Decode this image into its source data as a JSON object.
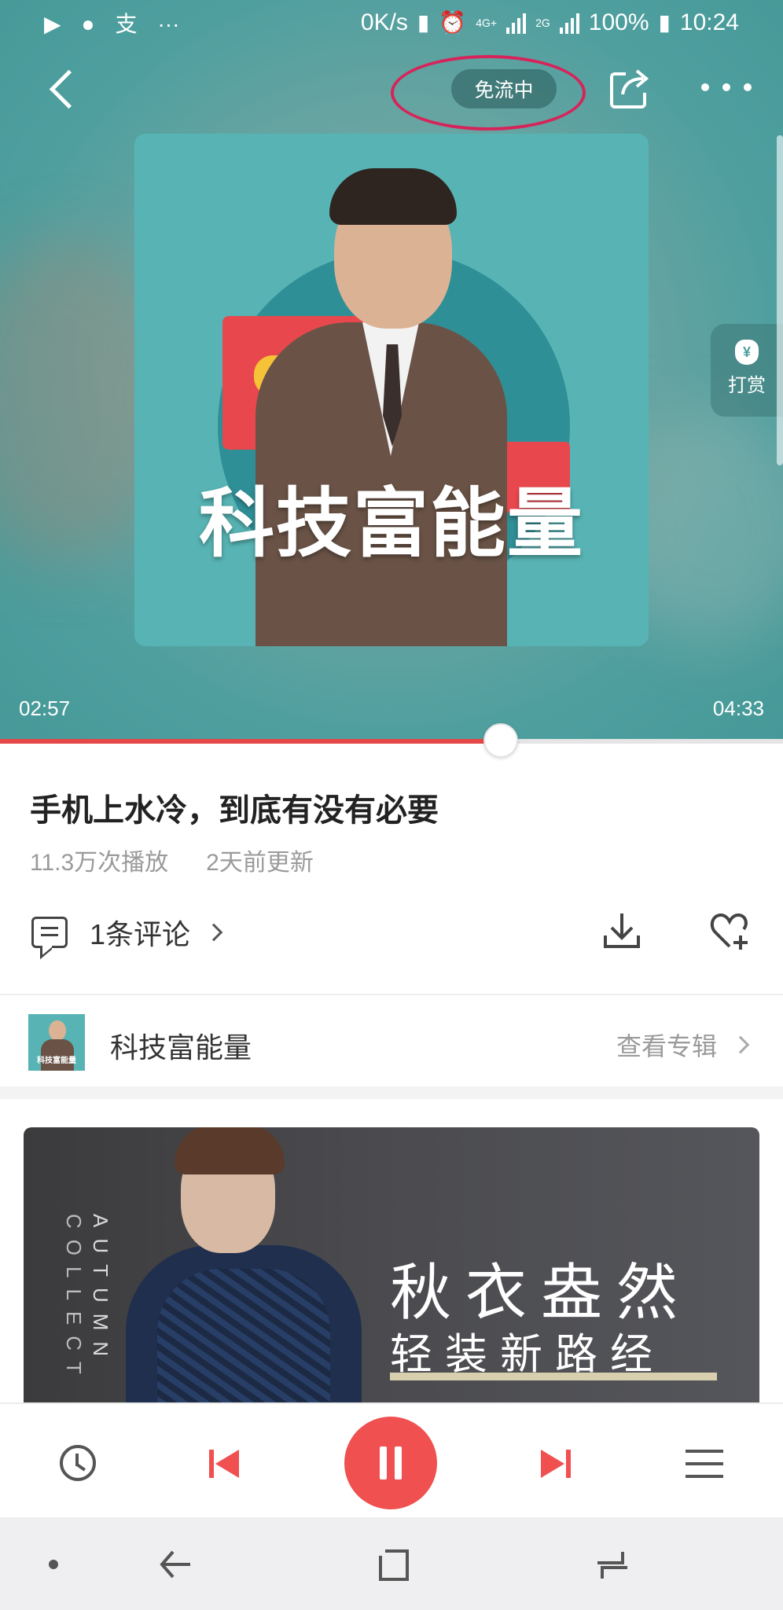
{
  "status_bar": {
    "network_speed": "0K/s",
    "battery": "100%",
    "time": "10:24",
    "net_4g": "4G+",
    "net_2g": "2G"
  },
  "header": {
    "free_badge": "免流中"
  },
  "cover": {
    "title": "科技富能量",
    "thumb_caption": "科技富能量"
  },
  "tip": {
    "label": "打赏"
  },
  "player": {
    "current_time": "02:57",
    "total_time": "04:33",
    "progress_fraction": 0.64
  },
  "episode": {
    "title": "手机上水冷，到底有没有必要",
    "plays": "11.3万次播放",
    "updated": "2天前更新"
  },
  "actions": {
    "comments": "1条评论"
  },
  "album": {
    "name": "科技富能量",
    "view_link": "查看专辑"
  },
  "ad": {
    "vertical_1": "AUTUMN",
    "vertical_2": "COLLECT",
    "headline": "秋衣盎然",
    "subline": "轻装新路经"
  },
  "colors": {
    "accent": "#f05050",
    "hero_bg": "#4f9f9f",
    "highlight_ring": "#d6245a"
  }
}
